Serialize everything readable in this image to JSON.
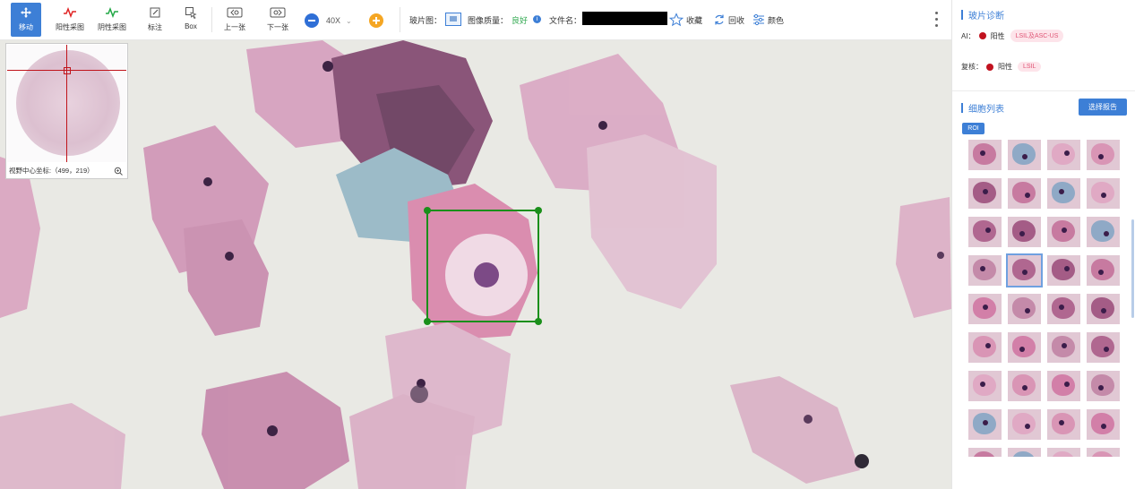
{
  "toolbar": {
    "move_label": "移动",
    "pos_sample_label": "阳性采图",
    "neg_sample_label": "阴性采图",
    "annotate_label": "标注",
    "box_label": "Box",
    "prev_label": "上一张",
    "next_label": "下一张",
    "zoom_value": "40X",
    "slide_label": "玻片图：",
    "quality_label": "图像质量：",
    "quality_value": "良好",
    "filename_label": "文件名：",
    "favorite_label": "收藏",
    "recycle_label": "回收",
    "color_label": "颜色"
  },
  "minimap": {
    "coords_text": "视野中心坐标:（499，219）"
  },
  "sidebar": {
    "diagnosis_title": "玻片诊断",
    "ai_label": "AI：",
    "ai_result": "阳性",
    "ai_tag": "LSIL及ASC-US",
    "review_label": "复核：",
    "review_result": "阳性",
    "review_tag": "LSIL",
    "cell_list_title": "细胞列表",
    "select_report_label": "选择报告",
    "roi_label": "ROI"
  },
  "colors": {
    "accent": "#3d7fd6",
    "positive": "#c1121f",
    "quality_good": "#2fa84f",
    "roi_box": "#1a8f1a"
  }
}
